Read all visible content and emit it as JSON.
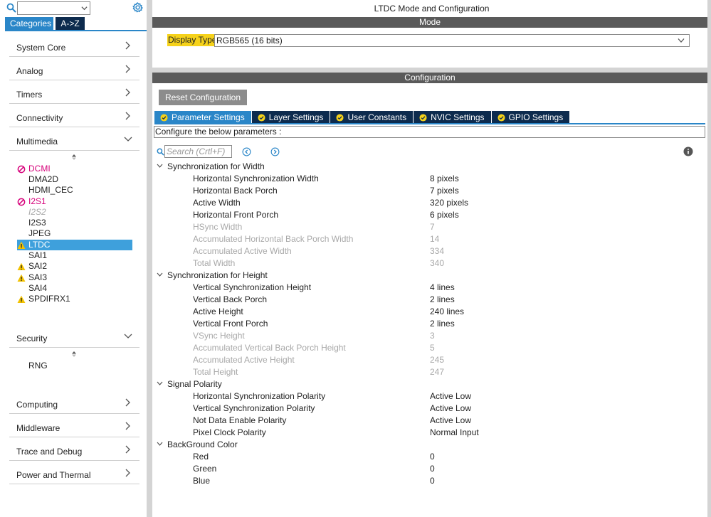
{
  "sidebar": {
    "search": {
      "placeholder": ""
    },
    "tabs": {
      "categories": "Categories",
      "az": "A->Z"
    },
    "categories": [
      {
        "label": "System Core"
      },
      {
        "label": "Analog"
      },
      {
        "label": "Timers"
      },
      {
        "label": "Connectivity"
      },
      {
        "label": "Multimedia"
      },
      {
        "label": "Security"
      },
      {
        "label": "Computing"
      },
      {
        "label": "Middleware"
      },
      {
        "label": "Trace and Debug"
      },
      {
        "label": "Power and Thermal"
      }
    ],
    "multimedia_items": [
      {
        "label": "DCMI",
        "status": "error"
      },
      {
        "label": "DMA2D",
        "status": "none"
      },
      {
        "label": "HDMI_CEC",
        "status": "none"
      },
      {
        "label": "I2S1",
        "status": "error"
      },
      {
        "label": "I2S2",
        "status": "disabled"
      },
      {
        "label": "I2S3",
        "status": "none"
      },
      {
        "label": "JPEG",
        "status": "none"
      },
      {
        "label": "LTDC",
        "status": "warning",
        "selected": true
      },
      {
        "label": "SAI1",
        "status": "none"
      },
      {
        "label": "SAI2",
        "status": "warning"
      },
      {
        "label": "SAI3",
        "status": "warning"
      },
      {
        "label": "SAI4",
        "status": "none"
      },
      {
        "label": "SPDIFRX1",
        "status": "warning"
      }
    ],
    "security_items": [
      {
        "label": "RNG",
        "status": "none"
      }
    ]
  },
  "main": {
    "title": "LTDC Mode and Configuration",
    "mode_header": "Mode",
    "display_type": {
      "label": "Display Type",
      "value": "RGB565 (16 bits)"
    },
    "config_header": "Configuration",
    "reset_button": "Reset Configuration",
    "tabs": [
      {
        "label": "Parameter Settings",
        "active": true
      },
      {
        "label": "Layer Settings"
      },
      {
        "label": "User Constants"
      },
      {
        "label": "NVIC Settings"
      },
      {
        "label": "GPIO Settings"
      }
    ],
    "description": "Configure the below parameters :",
    "search_placeholder": "Search (Crtl+F)",
    "groups": [
      {
        "title": "Synchronization for Width",
        "params": [
          {
            "name": "Horizontal Synchronization Width",
            "value": "8 pixels",
            "readonly": false
          },
          {
            "name": "Horizontal Back Porch",
            "value": "7 pixels",
            "readonly": false
          },
          {
            "name": "Active Width",
            "value": "320 pixels",
            "readonly": false
          },
          {
            "name": "Horizontal Front Porch",
            "value": "6 pixels",
            "readonly": false
          },
          {
            "name": "HSync Width",
            "value": "7",
            "readonly": true
          },
          {
            "name": "Accumulated Horizontal Back Porch Width",
            "value": "14",
            "readonly": true
          },
          {
            "name": "Accumulated Active Width",
            "value": "334",
            "readonly": true
          },
          {
            "name": "Total Width",
            "value": "340",
            "readonly": true
          }
        ]
      },
      {
        "title": "Synchronization for Height",
        "params": [
          {
            "name": "Vertical Synchronization Height",
            "value": "4 lines",
            "readonly": false
          },
          {
            "name": "Vertical Back Porch",
            "value": "2 lines",
            "readonly": false
          },
          {
            "name": "Active Height",
            "value": "240 lines",
            "readonly": false
          },
          {
            "name": "Vertical Front Porch",
            "value": "2 lines",
            "readonly": false
          },
          {
            "name": "VSync Height",
            "value": "3",
            "readonly": true
          },
          {
            "name": "Accumulated Vertical Back Porch Height",
            "value": "5",
            "readonly": true
          },
          {
            "name": "Accumulated Active Height",
            "value": "245",
            "readonly": true
          },
          {
            "name": "Total Height",
            "value": "247",
            "readonly": true
          }
        ]
      },
      {
        "title": "Signal Polarity",
        "params": [
          {
            "name": "Horizontal Synchronization Polarity",
            "value": "Active Low",
            "readonly": false
          },
          {
            "name": "Vertical Synchronization Polarity",
            "value": "Active Low",
            "readonly": false
          },
          {
            "name": "Not Data Enable Polarity",
            "value": "Active Low",
            "readonly": false
          },
          {
            "name": "Pixel Clock Polarity",
            "value": "Normal Input",
            "readonly": false
          }
        ]
      },
      {
        "title": "BackGround Color",
        "params": [
          {
            "name": "Red",
            "value": "0",
            "readonly": false
          },
          {
            "name": "Green",
            "value": "0",
            "readonly": false
          },
          {
            "name": "Blue",
            "value": "0",
            "readonly": false
          }
        ]
      }
    ]
  },
  "colors": {
    "accent_blue": "#2a86c8",
    "dark_tab": "#0d2b4e",
    "error_magenta": "#d6007a",
    "warning_yellow": "#f2c200",
    "highlight_yellow": "#f6d21a"
  }
}
